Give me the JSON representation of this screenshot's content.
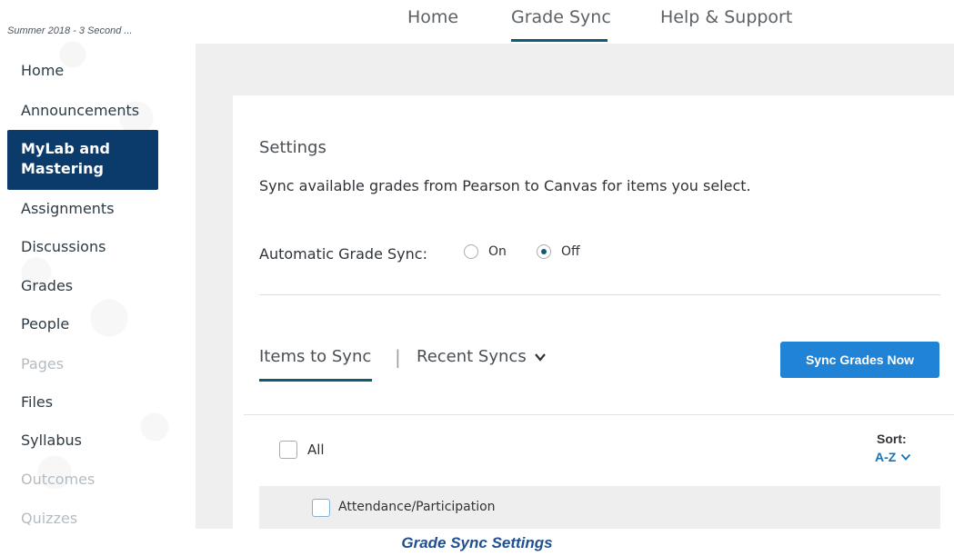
{
  "sidebar": {
    "course_title": "Summer 2018 - 3 Second ...",
    "items": [
      {
        "label": "Home",
        "state": "normal"
      },
      {
        "label": "Announcements",
        "state": "normal"
      },
      {
        "label": "MyLab and Mastering",
        "state": "active"
      },
      {
        "label": "Assignments",
        "state": "normal"
      },
      {
        "label": "Discussions",
        "state": "normal"
      },
      {
        "label": "Grades",
        "state": "normal"
      },
      {
        "label": "People",
        "state": "normal"
      },
      {
        "label": "Pages",
        "state": "disabled"
      },
      {
        "label": "Files",
        "state": "normal"
      },
      {
        "label": "Syllabus",
        "state": "normal"
      },
      {
        "label": "Outcomes",
        "state": "disabled"
      },
      {
        "label": "Quizzes",
        "state": "disabled"
      }
    ],
    "active_label_line1": "MyLab and",
    "active_label_line2": "Mastering"
  },
  "topnav": {
    "tabs": [
      {
        "label": "Home",
        "selected": false
      },
      {
        "label": "Grade Sync",
        "selected": true
      },
      {
        "label": "Help & Support",
        "selected": false
      }
    ]
  },
  "settings": {
    "heading": "Settings",
    "description": "Sync available grades from Pearson to Canvas for items you select.",
    "auto_sync_label": "Automatic Grade Sync:",
    "options": [
      {
        "label": "On",
        "checked": false
      },
      {
        "label": "Off",
        "checked": true
      }
    ]
  },
  "sync_tabs": {
    "items_to_sync": "Items to Sync",
    "separator": "|",
    "recent_syncs": "Recent Syncs",
    "sync_button": "Sync Grades Now"
  },
  "list": {
    "all_label": "All",
    "sort_label": "Sort:",
    "sort_value": "A-Z",
    "items": [
      "Attendance/Participation"
    ]
  },
  "caption": "Grade Sync Settings",
  "colors": {
    "active_nav_bg": "#0b3b6b",
    "accent_underline": "#0f5b76",
    "sync_button_bg": "#2083d5",
    "caption": "#1f4f8f"
  }
}
